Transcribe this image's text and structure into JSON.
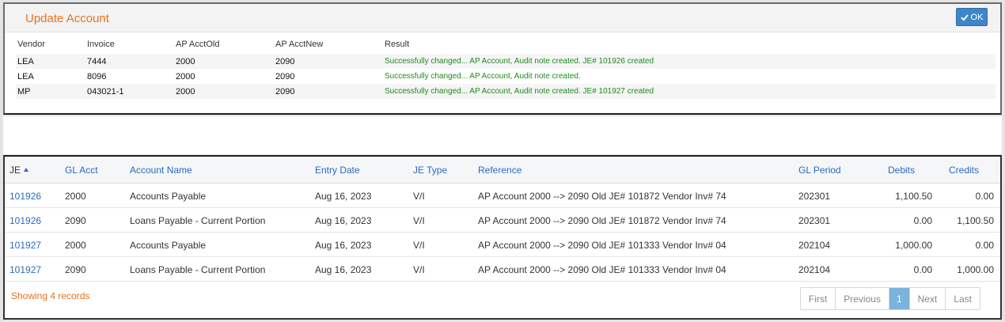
{
  "dialog": {
    "title": "Update Account",
    "ok_label": "OK",
    "columns": [
      "Vendor",
      "Invoice",
      "AP AcctOld",
      "AP AcctNew",
      "Result"
    ],
    "rows": [
      {
        "vendor": "LEA",
        "invoice": "7444",
        "old": "2000",
        "new": "2090",
        "result": "Successfully changed... AP Account, Audit note created. JE# 101926 created"
      },
      {
        "vendor": "LEA",
        "invoice": "8096",
        "old": "2000",
        "new": "2090",
        "result": "Successfully changed... AP Account, Audit note created."
      },
      {
        "vendor": "MP",
        "invoice": "043021-1",
        "old": "2000",
        "new": "2090",
        "result": "Successfully changed... AP Account, Audit note created. JE# 101927 created"
      }
    ]
  },
  "grid": {
    "columns": {
      "je": "JE",
      "gl_acct": "GL Acct",
      "account_name": "Account Name",
      "entry_date": "Entry Date",
      "je_type": "JE Type",
      "reference": "Reference",
      "gl_period": "GL Period",
      "debits": "Debits",
      "credits": "Credits"
    },
    "rows": [
      {
        "je": "101926",
        "gl_acct": "2000",
        "account_name": "Accounts Payable",
        "entry_date": "Aug 16, 2023",
        "je_type": "V/I",
        "reference": "AP Account 2000 --> 2090 Old JE# 101872 Vendor Inv# 74",
        "gl_period": "202301",
        "debits": "1,100.50",
        "credits": "0.00"
      },
      {
        "je": "101926",
        "gl_acct": "2090",
        "account_name": "Loans Payable - Current Portion",
        "entry_date": "Aug 16, 2023",
        "je_type": "V/I",
        "reference": "AP Account 2000 --> 2090 Old JE# 101872 Vendor Inv# 74",
        "gl_period": "202301",
        "debits": "0.00",
        "credits": "1,100.50"
      },
      {
        "je": "101927",
        "gl_acct": "2000",
        "account_name": "Accounts Payable",
        "entry_date": "Aug 16, 2023",
        "je_type": "V/I",
        "reference": "AP Account 2000 --> 2090 Old JE# 101333 Vendor Inv# 04",
        "gl_period": "202104",
        "debits": "1,000.00",
        "credits": "0.00"
      },
      {
        "je": "101927",
        "gl_acct": "2090",
        "account_name": "Loans Payable - Current Portion",
        "entry_date": "Aug 16, 2023",
        "je_type": "V/I",
        "reference": "AP Account 2000 --> 2090 Old JE# 101333 Vendor Inv# 04",
        "gl_period": "202104",
        "debits": "0.00",
        "credits": "1,000.00"
      }
    ],
    "footer": "Showing 4 records",
    "pager": {
      "first": "First",
      "previous": "Previous",
      "current": "1",
      "next": "Next",
      "last": "Last"
    }
  },
  "colors": {
    "accent_orange": "#e8731f",
    "link_blue": "#2a6ac0",
    "ok_blue": "#3e86c8",
    "success_green": "#1f8a1f",
    "page_active": "#7ab3dc"
  }
}
